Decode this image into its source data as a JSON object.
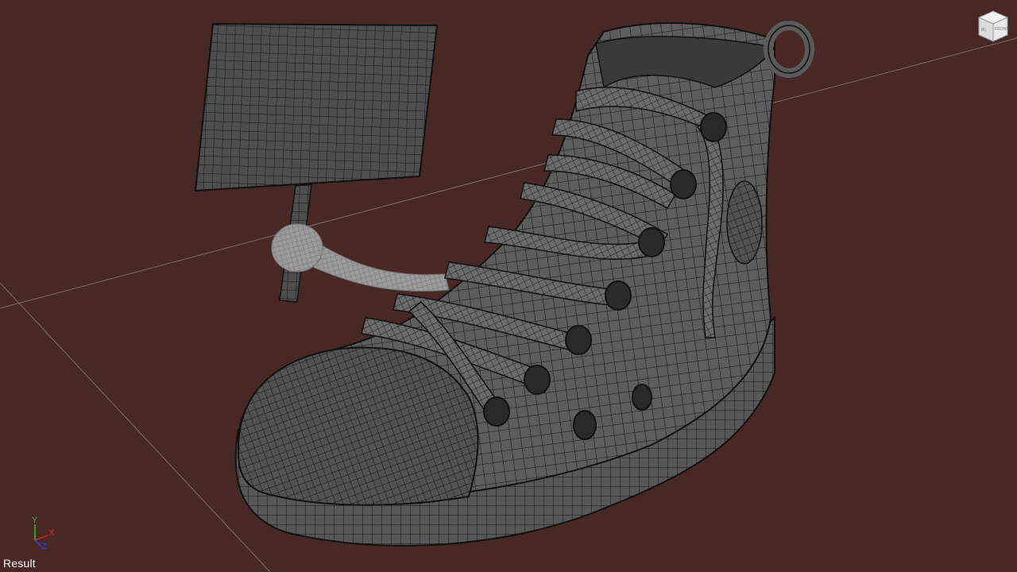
{
  "viewport": {
    "background": "#472824",
    "view_label": "Result"
  },
  "axis_gizmo": {
    "y_label": "Y",
    "x_label": "X",
    "z_label": "Z",
    "y_color": "#22cc22",
    "x_color": "#dd2222",
    "z_color": "#2244ee"
  },
  "view_cube": {
    "front_label": "FRONT",
    "left_label": "BL"
  },
  "scene": {
    "object": "sneaker-wireframe-model",
    "wire_color": "#111111",
    "surface_color": "#5a5a5a",
    "grid_line_color": "#8a7a74"
  }
}
